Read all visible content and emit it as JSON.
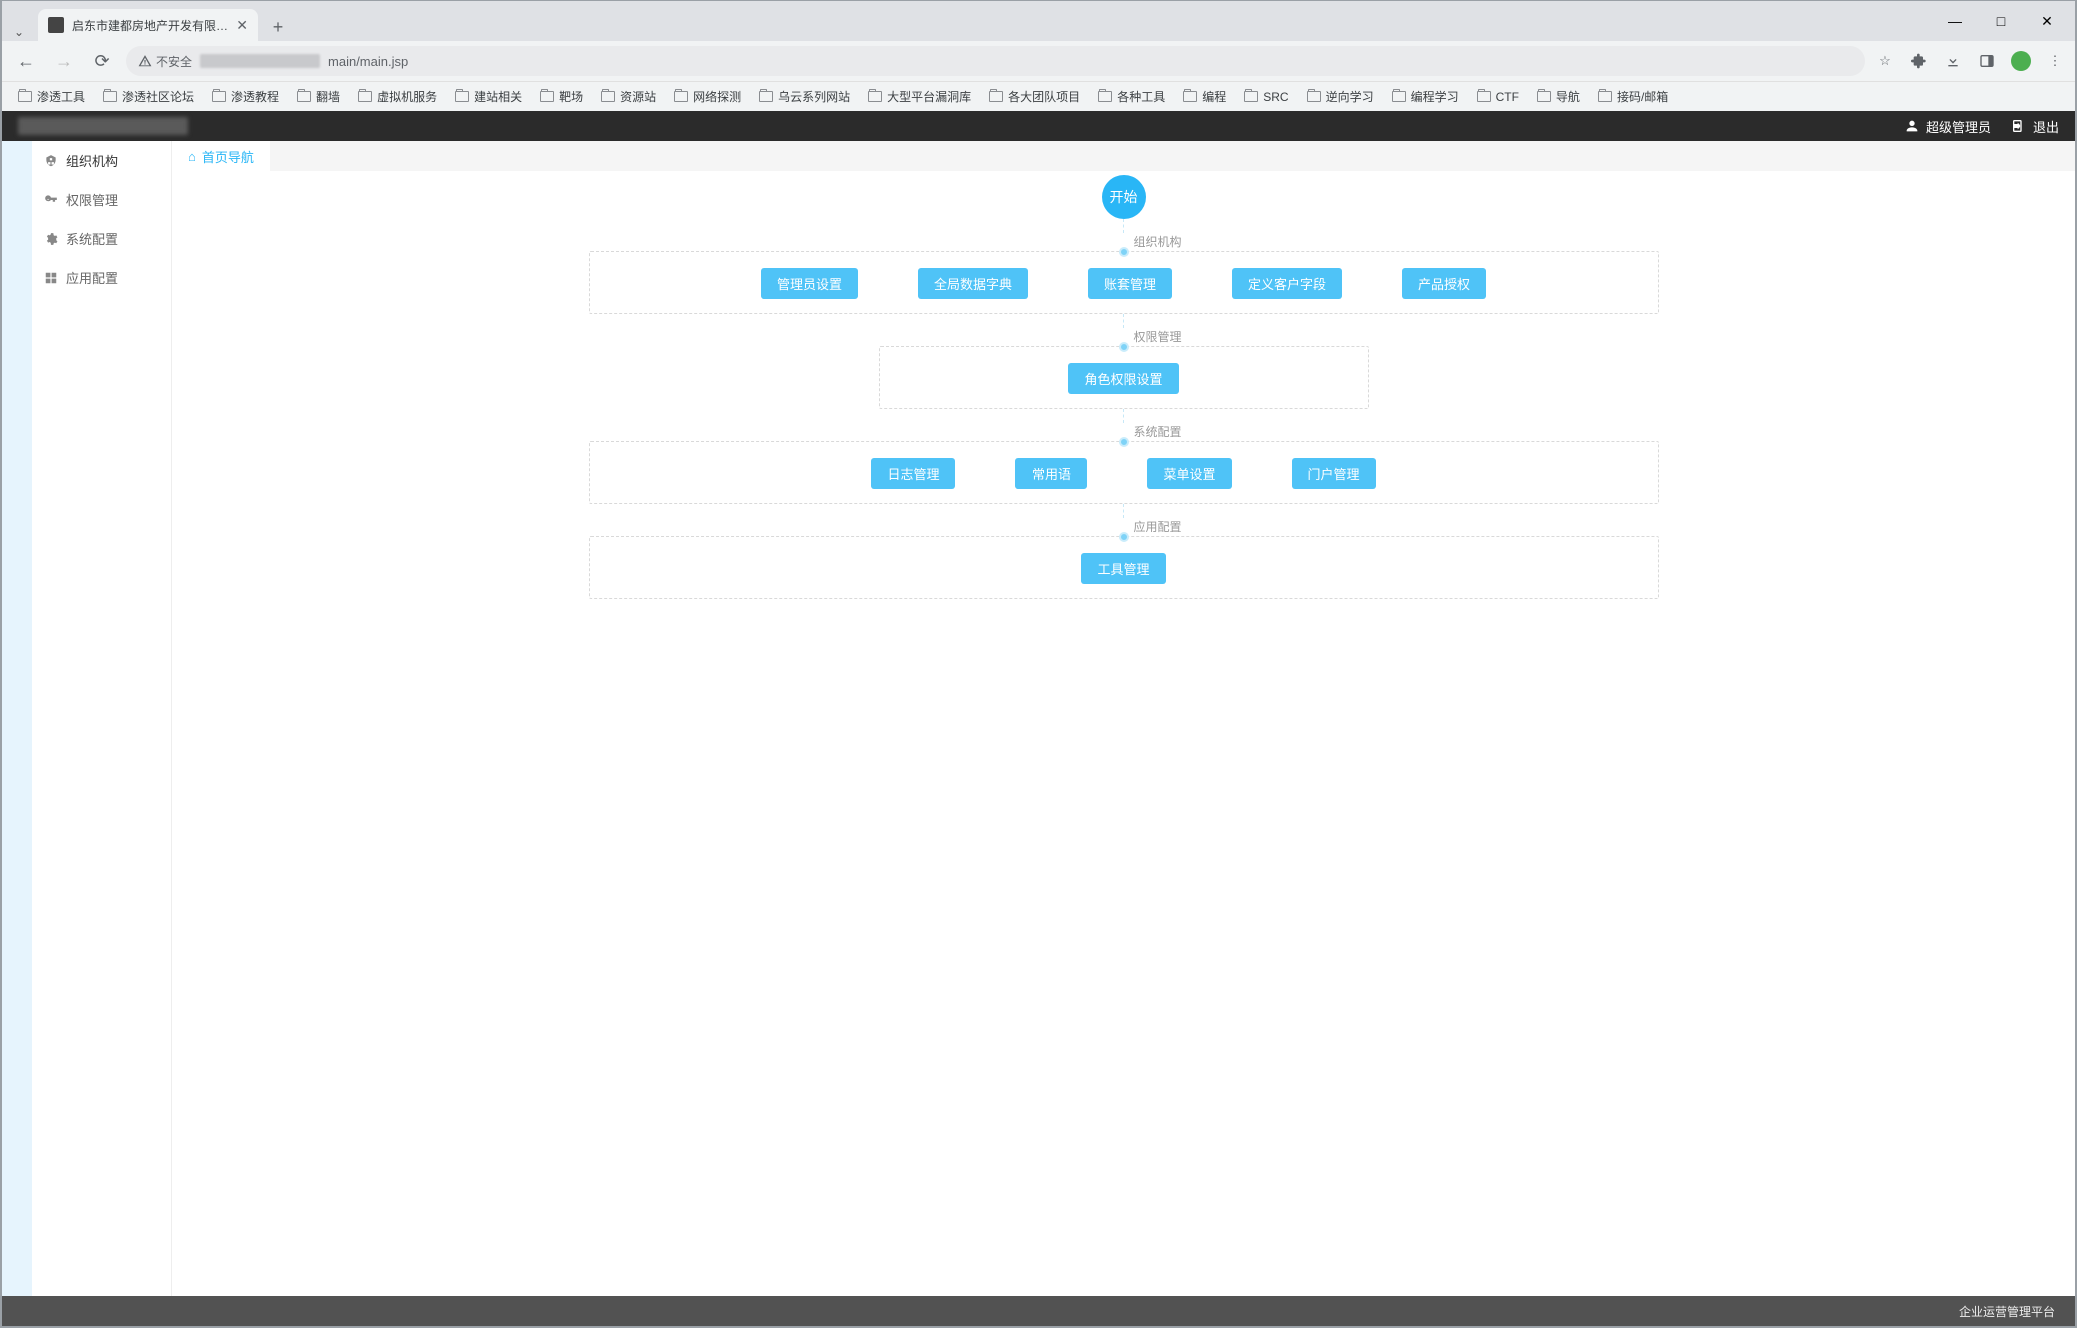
{
  "browser": {
    "tab_title": "启东市建都房地产开发有限公司",
    "url_security": "不安全",
    "url_visible": "main/main.jsp",
    "window_min": "—",
    "window_max": "□",
    "window_close": "✕",
    "bookmarks": [
      "渗透工具",
      "渗透社区论坛",
      "渗透教程",
      "翻墙",
      "虚拟机服务",
      "建站相关",
      "靶场",
      "资源站",
      "网络探测",
      "乌云系列网站",
      "大型平台漏洞库",
      "各大团队项目",
      "各种工具",
      "编程",
      "SRC",
      "逆向学习",
      "编程学习",
      "CTF",
      "导航",
      "接码/邮箱"
    ]
  },
  "header": {
    "user_role": "超级管理员",
    "logout": "退出"
  },
  "sidebar": {
    "items": [
      "组织机构",
      "权限管理",
      "系统配置",
      "应用配置"
    ]
  },
  "tabs": {
    "home": "首页导航"
  },
  "flow": {
    "start": "开始",
    "sections": [
      {
        "label": "组织机构",
        "buttons": [
          "管理员设置",
          "全局数据字典",
          "账套管理",
          "定义客户字段",
          "产品授权"
        ]
      },
      {
        "label": "权限管理",
        "buttons": [
          "角色权限设置"
        ]
      },
      {
        "label": "系统配置",
        "buttons": [
          "日志管理",
          "常用语",
          "菜单设置",
          "门户管理"
        ]
      },
      {
        "label": "应用配置",
        "buttons": [
          "工具管理"
        ]
      }
    ]
  },
  "footer": {
    "text": "企业运营管理平台"
  }
}
